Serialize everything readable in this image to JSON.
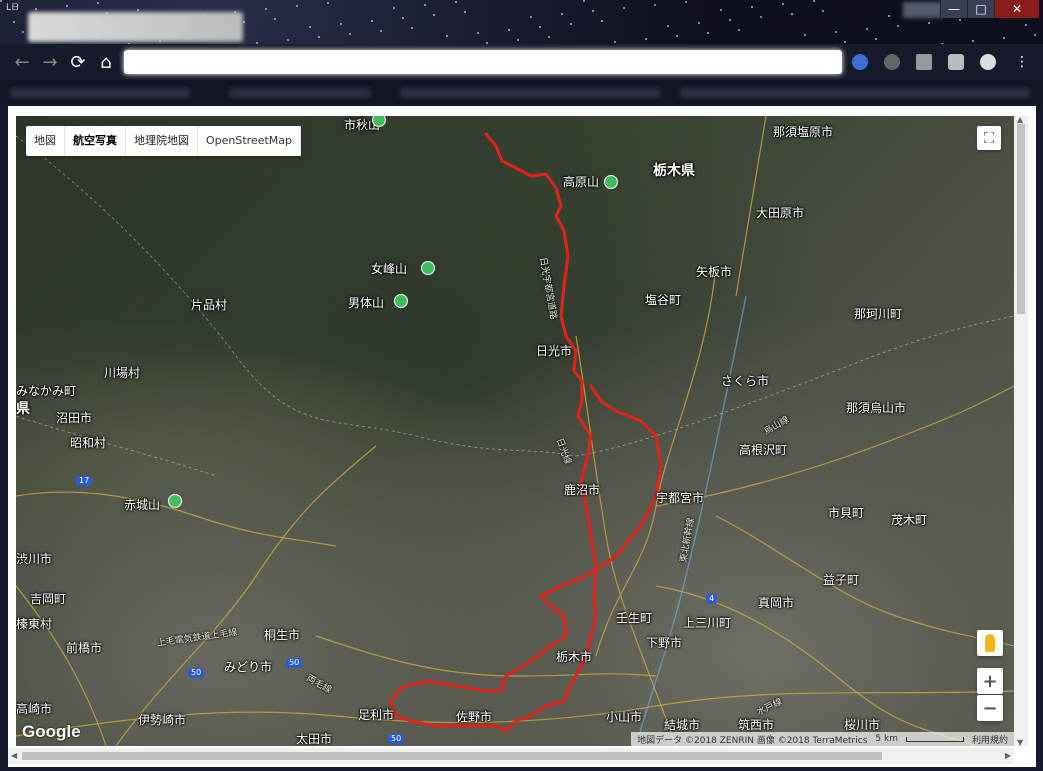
{
  "window": {
    "minimize_label": "—",
    "maximize_label": "□",
    "close_label": "✕"
  },
  "toolbar": {
    "back_icon": "back-arrow-icon",
    "forward_icon": "forward-arrow-icon",
    "reload_icon": "reload-icon",
    "home_icon": "home-icon"
  },
  "map": {
    "map_types": [
      "地図",
      "航空写真",
      "地理院地図",
      "OpenStreetMap"
    ],
    "selected_map_type": "航空写真",
    "zoom_in_label": "+",
    "zoom_out_label": "−",
    "google_logo": "Google",
    "attribution": "地図データ ©2018 ZENRIN 画像 ©2018 TerraMetrics",
    "scale_label": "5 km",
    "terms_label": "利用規約",
    "labels": [
      {
        "text": "那須塩原市",
        "big": false
      },
      {
        "text": "栃木県",
        "big": true
      },
      {
        "text": "高原山",
        "big": false
      },
      {
        "text": "大田原市",
        "big": false
      },
      {
        "text": "女峰山",
        "big": false
      },
      {
        "text": "矢板市",
        "big": false
      },
      {
        "text": "片品村",
        "big": false
      },
      {
        "text": "男体山",
        "big": false
      },
      {
        "text": "塩谷町",
        "big": false
      },
      {
        "text": "那珂川町",
        "big": false
      },
      {
        "text": "日光市",
        "big": false
      },
      {
        "text": "川場村",
        "big": false
      },
      {
        "text": "みなかみ町",
        "big": false
      },
      {
        "text": "さくら市",
        "big": false
      },
      {
        "text": "県",
        "big": true
      },
      {
        "text": "沼田市",
        "big": false
      },
      {
        "text": "那須烏山市",
        "big": false
      },
      {
        "text": "昭和村",
        "big": false
      },
      {
        "text": "高根沢町",
        "big": false
      },
      {
        "text": "赤城山",
        "big": false
      },
      {
        "text": "鹿沼市",
        "big": false
      },
      {
        "text": "宇都宮市",
        "big": false
      },
      {
        "text": "市貝町",
        "big": false
      },
      {
        "text": "茂木町",
        "big": false
      },
      {
        "text": "渋川市",
        "big": false
      },
      {
        "text": "益子町",
        "big": false
      },
      {
        "text": "吉岡町",
        "big": false
      },
      {
        "text": "真岡市",
        "big": false
      },
      {
        "text": "榛東村",
        "big": false
      },
      {
        "text": "壬生町",
        "big": false
      },
      {
        "text": "上三川町",
        "big": false
      },
      {
        "text": "前橋市",
        "big": false
      },
      {
        "text": "桐生市",
        "big": false
      },
      {
        "text": "下野市",
        "big": false
      },
      {
        "text": "みどり市",
        "big": false
      },
      {
        "text": "栃木市",
        "big": false
      },
      {
        "text": "高崎市",
        "big": false
      },
      {
        "text": "伊勢崎市",
        "big": false
      },
      {
        "text": "足利市",
        "big": false
      },
      {
        "text": "佐野市",
        "big": false
      },
      {
        "text": "小山市",
        "big": false
      },
      {
        "text": "結城市",
        "big": false
      },
      {
        "text": "筑西市",
        "big": false
      },
      {
        "text": "桜川市",
        "big": false
      },
      {
        "text": "太田市",
        "big": false
      },
      {
        "text": "市秋山",
        "big": false
      }
    ],
    "route_labels": [
      "日光宇都宮道路",
      "日光線",
      "上毛電気鉄道上毛線",
      "両毛線",
      "烏山線",
      "水戸線",
      "東北新幹線"
    ],
    "road_shields": [
      "17",
      "50",
      "50",
      "50",
      "4"
    ],
    "route_color": "#e0241b"
  }
}
